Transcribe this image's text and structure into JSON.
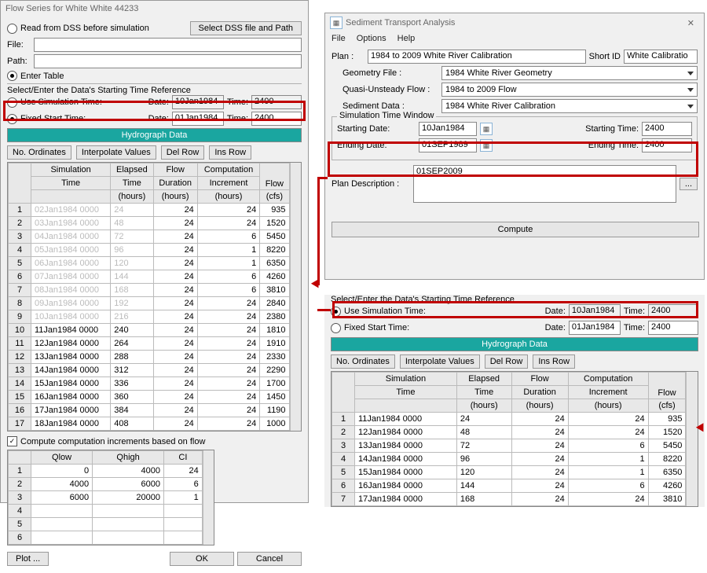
{
  "flowWin": {
    "title": "Flow Series for White White 44233",
    "readDss": "Read from DSS before simulation",
    "selectDss": "Select DSS file and Path",
    "fileLabel": "File:",
    "pathLabel": "Path:",
    "enterTable": "Enter Table",
    "selectHdr": "Select/Enter the Data's Starting Time Reference",
    "useSim": "Use Simulation Time:",
    "fixedStart": "Fixed Start Time:",
    "dateLabel": "Date:",
    "timeLabel": "Time:",
    "simDate": "10Jan1984",
    "simTime": "2400",
    "fixDate": "01Jan1984",
    "fixTime": "2400",
    "hydrographTitle": "Hydrograph Data",
    "btn_noOrd": "No. Ordinates",
    "btn_interp": "Interpolate Values",
    "btn_delRow": "Del Row",
    "btn_insRow": "Ins Row",
    "th_simTime": "Simulation",
    "th_simTime2": "Time",
    "th_elapsed": "Elapsed",
    "th_elapsed2": "Time",
    "th_elapsed3": "(hours)",
    "th_flow": "Flow",
    "th_flow2": "Duration",
    "th_flow3": "(hours)",
    "th_comp": "Computation",
    "th_comp2": "Increment",
    "th_comp3": "(hours)",
    "th_cfs": "Flow",
    "th_cfs2": "(cfs)",
    "rows": [
      {
        "n": "1",
        "t": "02Jan1984 0000",
        "ghost": true,
        "e": "24",
        "d": "24",
        "i": "24",
        "f": "935"
      },
      {
        "n": "2",
        "t": "03Jan1984 0000",
        "ghost": true,
        "e": "48",
        "d": "24",
        "i": "24",
        "f": "1520"
      },
      {
        "n": "3",
        "t": "04Jan1984 0000",
        "ghost": true,
        "e": "72",
        "d": "24",
        "i": "6",
        "f": "5450"
      },
      {
        "n": "4",
        "t": "05Jan1984 0000",
        "ghost": true,
        "e": "96",
        "d": "24",
        "i": "1",
        "f": "8220"
      },
      {
        "n": "5",
        "t": "06Jan1984 0000",
        "ghost": true,
        "e": "120",
        "d": "24",
        "i": "1",
        "f": "6350"
      },
      {
        "n": "6",
        "t": "07Jan1984 0000",
        "ghost": true,
        "e": "144",
        "d": "24",
        "i": "6",
        "f": "4260"
      },
      {
        "n": "7",
        "t": "08Jan1984 0000",
        "ghost": true,
        "e": "168",
        "d": "24",
        "i": "6",
        "f": "3810"
      },
      {
        "n": "8",
        "t": "09Jan1984 0000",
        "ghost": true,
        "e": "192",
        "d": "24",
        "i": "24",
        "f": "2840"
      },
      {
        "n": "9",
        "t": "10Jan1984 0000",
        "ghost": true,
        "e": "216",
        "d": "24",
        "i": "24",
        "f": "2380"
      },
      {
        "n": "10",
        "t": "11Jan1984 0000",
        "e": "240",
        "d": "24",
        "i": "24",
        "f": "1810"
      },
      {
        "n": "11",
        "t": "12Jan1984 0000",
        "e": "264",
        "d": "24",
        "i": "24",
        "f": "1910"
      },
      {
        "n": "12",
        "t": "13Jan1984 0000",
        "e": "288",
        "d": "24",
        "i": "24",
        "f": "2330"
      },
      {
        "n": "13",
        "t": "14Jan1984 0000",
        "e": "312",
        "d": "24",
        "i": "24",
        "f": "2290"
      },
      {
        "n": "14",
        "t": "15Jan1984 0000",
        "e": "336",
        "d": "24",
        "i": "24",
        "f": "1700"
      },
      {
        "n": "15",
        "t": "16Jan1984 0000",
        "e": "360",
        "d": "24",
        "i": "24",
        "f": "1450"
      },
      {
        "n": "16",
        "t": "17Jan1984 0000",
        "e": "384",
        "d": "24",
        "i": "24",
        "f": "1190"
      },
      {
        "n": "17",
        "t": "18Jan1984 0000",
        "e": "408",
        "d": "24",
        "i": "24",
        "f": "1000"
      }
    ],
    "computeChk": "Compute computation increments based on flow",
    "th_qlow": "Qlow",
    "th_qhigh": "Qhigh",
    "th_ci": "CI",
    "qRows": [
      {
        "n": "1",
        "l": "0",
        "h": "4000",
        "c": "24"
      },
      {
        "n": "2",
        "l": "4000",
        "h": "6000",
        "c": "6"
      },
      {
        "n": "3",
        "l": "6000",
        "h": "20000",
        "c": "1"
      },
      {
        "n": "4",
        "l": "",
        "h": "",
        "c": ""
      },
      {
        "n": "5",
        "l": "",
        "h": "",
        "c": ""
      },
      {
        "n": "6",
        "l": "",
        "h": "",
        "c": ""
      }
    ],
    "btn_plot": "Plot ...",
    "btn_ok": "OK",
    "btn_cancel": "Cancel"
  },
  "sedWin": {
    "title": "Sediment Transport Analysis",
    "m_file": "File",
    "m_opt": "Options",
    "m_help": "Help",
    "planLabel": "Plan :",
    "planVal": "1984 to 2009 White River Calibration",
    "shortIdLabel": "Short ID",
    "shortIdVal": "White Calibratio",
    "geomLabel": "Geometry File :",
    "geomVal": "1984 White River Geometry",
    "qusLabel": "Quasi-Unsteady Flow :",
    "qusVal": "1984 to 2009 Flow",
    "sedLabel": "Sediment Data :",
    "sedVal": "1984 White River Calibration",
    "simWindow": "Simulation Time Window",
    "startDateLabel": "Starting Date:",
    "startDate": "10Jan1984",
    "startTimeLabel": "Starting Time:",
    "startTime": "2400",
    "endDateLabel": "Ending Date:",
    "endDate": "01SEP1989",
    "endTimeLabel": "Ending Time:",
    "endTime": "2400",
    "planDescLabel": "Plan Description :",
    "planDescVal": "01SEP2009",
    "computeBtn": "Compute"
  },
  "frag": {
    "selectHdr": "Select/Enter the Data's Starting Time Reference",
    "useSim": "Use Simulation Time:",
    "fixedStart": "Fixed Start Time:",
    "dateLabel": "Date:",
    "timeLabel": "Time:",
    "simDate": "10Jan1984",
    "simTime": "2400",
    "fixDate": "01Jan1984",
    "fixTime": "2400",
    "hydrographTitle": "Hydrograph Data",
    "btn_noOrd": "No. Ordinates",
    "btn_interp": "Interpolate Values",
    "btn_delRow": "Del Row",
    "btn_insRow": "Ins Row",
    "rows": [
      {
        "n": "1",
        "t": "11Jan1984 0000",
        "e": "24",
        "d": "24",
        "i": "24",
        "f": "935"
      },
      {
        "n": "2",
        "t": "12Jan1984 0000",
        "e": "48",
        "d": "24",
        "i": "24",
        "f": "1520"
      },
      {
        "n": "3",
        "t": "13Jan1984 0000",
        "e": "72",
        "d": "24",
        "i": "6",
        "f": "5450"
      },
      {
        "n": "4",
        "t": "14Jan1984 0000",
        "e": "96",
        "d": "24",
        "i": "1",
        "f": "8220"
      },
      {
        "n": "5",
        "t": "15Jan1984 0000",
        "e": "120",
        "d": "24",
        "i": "1",
        "f": "6350"
      },
      {
        "n": "6",
        "t": "16Jan1984 0000",
        "e": "144",
        "d": "24",
        "i": "6",
        "f": "4260"
      },
      {
        "n": "7",
        "t": "17Jan1984 0000",
        "e": "168",
        "d": "24",
        "i": "24",
        "f": "3810"
      }
    ]
  }
}
